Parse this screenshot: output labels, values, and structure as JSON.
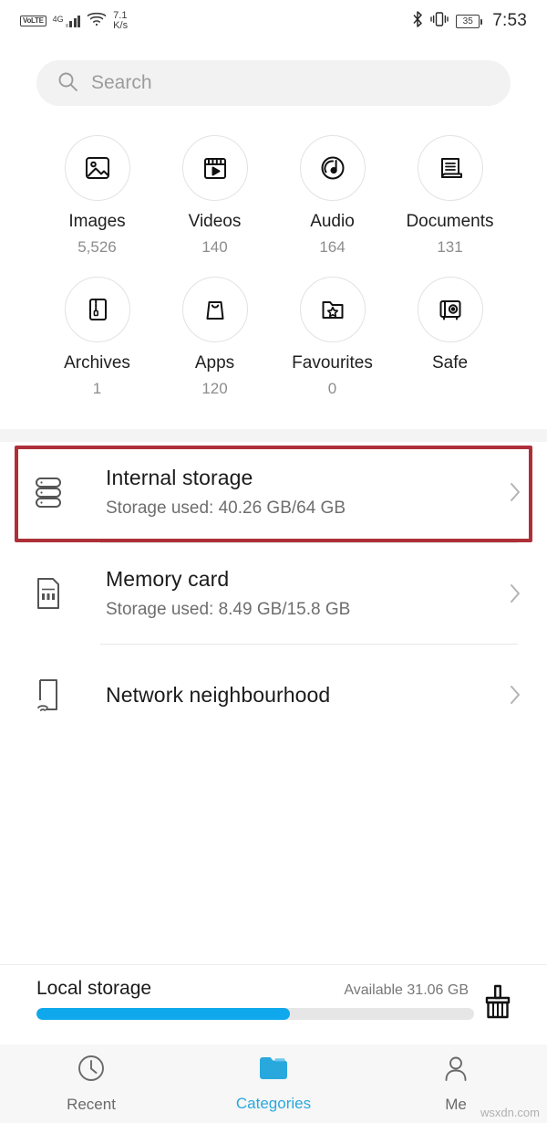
{
  "status_bar": {
    "volte": "VoLTE",
    "network_type": "4G",
    "data_rate_value": "7.1",
    "data_rate_unit": "K/s",
    "battery_level": "35",
    "time": "7:53",
    "icons": [
      "volte-badge",
      "signal-bars-icon",
      "wifi-icon",
      "bluetooth-icon",
      "vibrate-icon",
      "battery-icon"
    ]
  },
  "search": {
    "placeholder": "Search",
    "icon": "search-icon"
  },
  "categories": [
    {
      "label": "Images",
      "count": "5,526",
      "icon": "image-icon"
    },
    {
      "label": "Videos",
      "count": "140",
      "icon": "video-icon"
    },
    {
      "label": "Audio",
      "count": "164",
      "icon": "audio-disc-icon"
    },
    {
      "label": "Documents",
      "count": "131",
      "icon": "document-icon"
    },
    {
      "label": "Archives",
      "count": "1",
      "icon": "archive-zip-icon"
    },
    {
      "label": "Apps",
      "count": "120",
      "icon": "apps-bag-icon"
    },
    {
      "label": "Favourites",
      "count": "0",
      "icon": "favourite-folder-star-icon"
    },
    {
      "label": "Safe",
      "count": "",
      "icon": "safe-vault-icon"
    }
  ],
  "storage_list": [
    {
      "title": "Internal storage",
      "subtitle": "Storage used: 40.26 GB/64 GB",
      "icon": "internal-storage-stack-icon",
      "highlighted": true
    },
    {
      "title": "Memory card",
      "subtitle": "Storage used: 8.49 GB/15.8 GB",
      "icon": "memory-card-icon",
      "highlighted": false
    },
    {
      "title": "Network neighbourhood",
      "subtitle": "",
      "icon": "network-neighbourhood-icon",
      "highlighted": false
    }
  ],
  "local_storage": {
    "title": "Local storage",
    "available": "Available 31.06 GB",
    "used_percent": 58,
    "bar_color": "#10a8ec",
    "cleanup_icon": "broom-cleanup-icon"
  },
  "bottom_nav": [
    {
      "label": "Recent",
      "icon": "clock-icon",
      "active": false
    },
    {
      "label": "Categories",
      "icon": "folder-icon",
      "active": true
    },
    {
      "label": "Me",
      "icon": "person-icon",
      "active": false
    }
  ],
  "annotation": {
    "highlight_color": "#ad3039"
  },
  "watermark": "wsxdn.com"
}
